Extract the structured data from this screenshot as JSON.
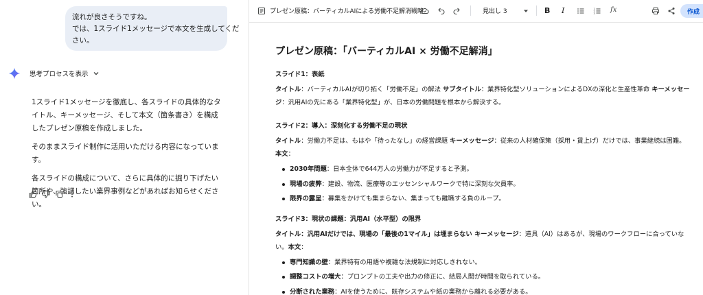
{
  "chat": {
    "user_message": [
      "流れが良さそうですね。",
      "では、1スライド1メッセージで本文を生成してくだ",
      "さい。"
    ],
    "thinking_label": "思考プロセスを表示",
    "answer_paragraphs": [
      "1スライド1メッセージを徹底し、各スライドの具体的なタイトル、キーメッセージ、そして本文（箇条書き）を構成したプレゼン原稿を作成しました。",
      "そのままスライド制作に活用いただける内容になっています。",
      "各スライドの構成について、さらに具体的に掘り下げたい箇所や、強調したい業界事例などがあればお知らせください。"
    ],
    "actions": [
      "thumb-up-icon",
      "thumb-down-icon",
      "copy-icon",
      "more-vert-icon"
    ]
  },
  "toolbar": {
    "doc_title": "プレゼン原稿：バーティカルAIによる労働不足解消戦略",
    "heading_style": "見出し 3",
    "create_label": "作成",
    "colors": {
      "accent": "#0b57d0",
      "button_bg": "#d3e3fd",
      "bubble_bg": "#e9eef6",
      "sparkle": "#4285f4"
    }
  },
  "doc": {
    "title": "プレゼン原稿：「バーティカルAI × 労働不足解消」",
    "s1": {
      "heading": "スライド1：表紙",
      "t_label": "タイトル",
      "t_text": "：バーティカルAIが切り拓く「労働不足」の解法 ",
      "st_label": "サブタイトル",
      "st_text": "：業界特化型ソリューションによるDXの深化と生産性革命 ",
      "km_label": "キーメッセージ",
      "km_text": "：汎用AIの先にある「業界特化型」が、日本の労働問題を根本から解決する。"
    },
    "s2": {
      "heading": "スライド2：導入：深刻化する労働不足の現状",
      "t_label": "タイトル",
      "t_text": "：労働力不足は、もはや「待ったなし」の経営課題 ",
      "km_label": "キーメッセージ",
      "km_text": "：従来の人材確保策（採用・賃上げ）だけでは、事業継続は困難。",
      "body_label": "本文",
      "body_colon": "：",
      "bullets": [
        {
          "label": "2030年問題",
          "text": "：日本全体で644万人の労働力が不足すると予測。"
        },
        {
          "label": "現場の疲弊",
          "text": "：建設、物流、医療等のエッセンシャルワークで特に深刻な欠員率。"
        },
        {
          "label": "限界の露呈",
          "text": "：募集をかけても集まらない、集まっても離職する負のループ。"
        }
      ]
    },
    "s3": {
      "heading": "スライド3：現状の課題：汎用AI（水平型）の限界",
      "t_label": "タイトル：汎用AIだけでは、現場の「最後の1マイル」は埋まらない",
      "km_label": " キーメッセージ",
      "km_text": "：道具（AI）はあるが、現場のワークフローに合っていな",
      "km_text2": "い。",
      "body_label": "本文",
      "body_colon": "：",
      "bullets": [
        {
          "label": "専門知識の壁",
          "text": "：業界特有の用語や複雑な法規制に対応しきれない。"
        },
        {
          "label": "調整コストの増大",
          "text": "：プロンプトの工夫や出力の修正に、結局人間が時間を取られている。"
        },
        {
          "label": "分断された業務",
          "text": "：AIを使うために、既存システムや紙の業務から離れる必要がある。"
        }
      ]
    }
  }
}
